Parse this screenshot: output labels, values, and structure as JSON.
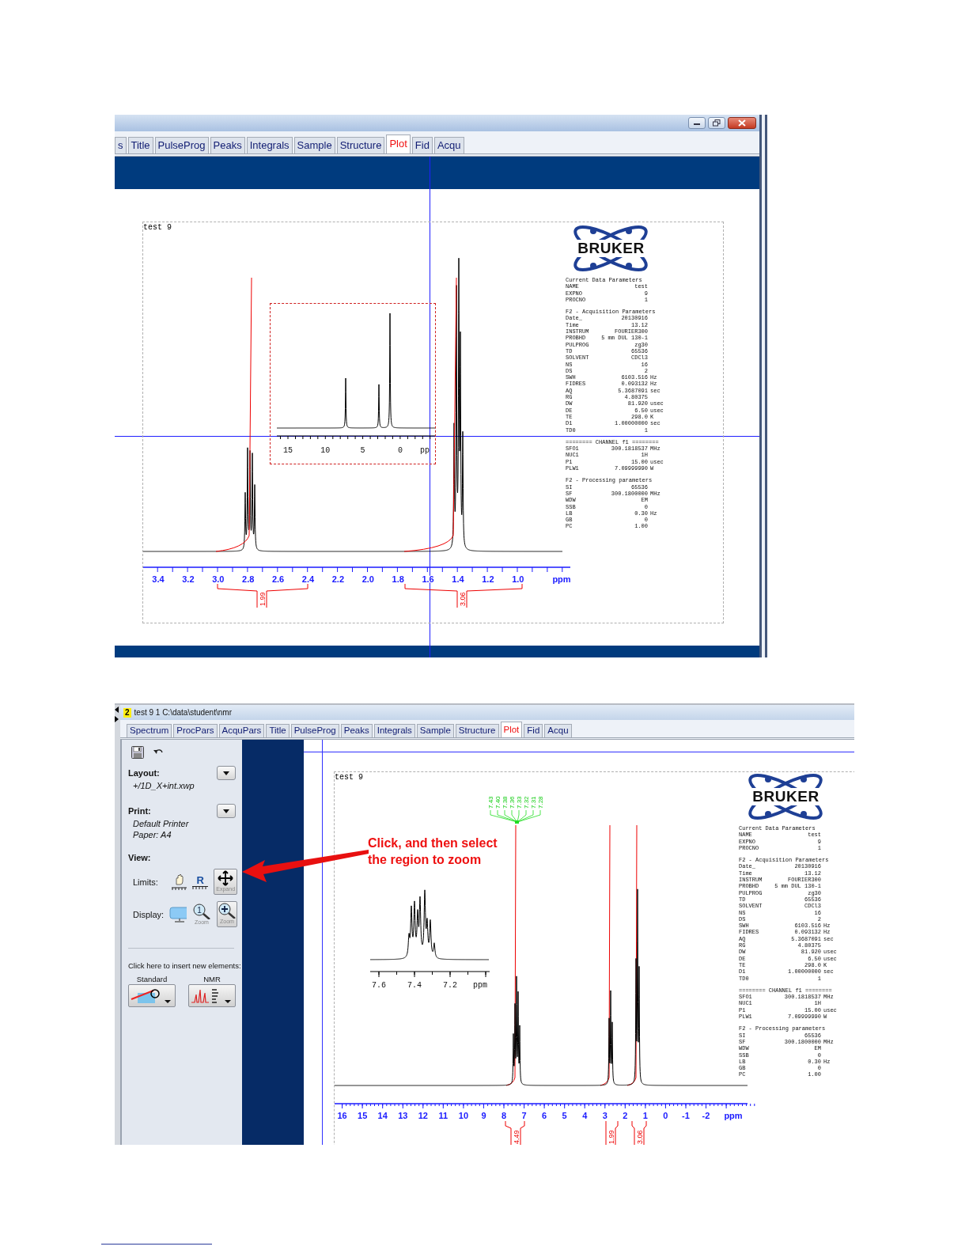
{
  "window_1": {
    "tabs": [
      {
        "label": "s",
        "selected": false
      },
      {
        "label": "Title",
        "selected": false
      },
      {
        "label": "PulseProg",
        "selected": false
      },
      {
        "label": "Peaks",
        "selected": false
      },
      {
        "label": "Integrals",
        "selected": false
      },
      {
        "label": "Sample",
        "selected": false
      },
      {
        "label": "Structure",
        "selected": false
      },
      {
        "label": "Plot",
        "selected": true
      },
      {
        "label": "Fid",
        "selected": false
      },
      {
        "label": "Acqu",
        "selected": false
      }
    ],
    "plot": {
      "page_title": "test 9",
      "logo": "BRUKER",
      "inset_axis_labels": [
        "15",
        "10",
        "5",
        "0"
      ],
      "inset_axis_unit": "pp",
      "axis_labels": [
        "3.4",
        "3.2",
        "3.0",
        "2.8",
        "2.6",
        "2.4",
        "2.2",
        "2.0",
        "1.8",
        "1.6",
        "1.4",
        "1.2",
        "1.0"
      ],
      "axis_unit": "ppm",
      "integrals": [
        "1.99",
        "3.06"
      ],
      "params": [
        {
          "title": "Current Data Parameters",
          "rows": [
            {
              "name": "NAME",
              "value": "test"
            },
            {
              "name": "EXPNO",
              "value": "9"
            },
            {
              "name": "PROCNO",
              "value": "1"
            }
          ]
        },
        {
          "title": "F2 - Acquisition Parameters",
          "rows": [
            {
              "name": "Date_",
              "value": "20130916"
            },
            {
              "name": "Time",
              "value": "13.12"
            },
            {
              "name": "INSTRUM",
              "value": "FOURIER300"
            },
            {
              "name": "PROBHD",
              "value": "5 mm DUL 130-1"
            },
            {
              "name": "PULPROG",
              "value": "zg30"
            },
            {
              "name": "TD",
              "value": "65536"
            },
            {
              "name": "SOLVENT",
              "value": "CDCl3"
            },
            {
              "name": "NS",
              "value": "16"
            },
            {
              "name": "DS",
              "value": "2"
            },
            {
              "name": "SWH",
              "value": "6103.516",
              "unit": "Hz"
            },
            {
              "name": "FIDRES",
              "value": "0.093132",
              "unit": "Hz"
            },
            {
              "name": "AQ",
              "value": "5.3687091",
              "unit": "sec"
            },
            {
              "name": "RG",
              "value": "4.80375"
            },
            {
              "name": "DW",
              "value": "81.920",
              "unit": "usec"
            },
            {
              "name": "DE",
              "value": "6.50",
              "unit": "usec"
            },
            {
              "name": "TE",
              "value": "298.0",
              "unit": "K"
            },
            {
              "name": "D1",
              "value": "1.00000000",
              "unit": "sec"
            },
            {
              "name": "TD0",
              "value": "1"
            }
          ]
        },
        {
          "title": "======== CHANNEL f1 ========",
          "rows": [
            {
              "name": "SFO1",
              "value": "300.1818537",
              "unit": "MHz"
            },
            {
              "name": "NUC1",
              "value": "1H"
            },
            {
              "name": "P1",
              "value": "15.00",
              "unit": "usec"
            },
            {
              "name": "PLW1",
              "value": "7.09999990",
              "unit": "W"
            }
          ]
        },
        {
          "title": "F2 - Processing parameters",
          "rows": [
            {
              "name": "SI",
              "value": "65536"
            },
            {
              "name": "SF",
              "value": "300.1800000",
              "unit": "MHz"
            },
            {
              "name": "WDW",
              "value": "EM"
            },
            {
              "name": "SSB",
              "value": "0"
            },
            {
              "name": "LB",
              "value": "0.30",
              "unit": "Hz"
            },
            {
              "name": "GB",
              "value": "0"
            },
            {
              "name": "PC",
              "value": "1.00"
            }
          ]
        }
      ]
    }
  },
  "window_2": {
    "badge": "2",
    "title": "test 9 1 C:\\data\\student\\nmr",
    "tabs": [
      {
        "label": "Spectrum",
        "selected": false
      },
      {
        "label": "ProcPars",
        "selected": false
      },
      {
        "label": "AcquPars",
        "selected": false
      },
      {
        "label": "Title",
        "selected": false
      },
      {
        "label": "PulseProg",
        "selected": false
      },
      {
        "label": "Peaks",
        "selected": false
      },
      {
        "label": "Integrals",
        "selected": false
      },
      {
        "label": "Sample",
        "selected": false
      },
      {
        "label": "Structure",
        "selected": false
      },
      {
        "label": "Plot",
        "selected": true
      },
      {
        "label": "Fid",
        "selected": false
      },
      {
        "label": "Acqu",
        "selected": false
      }
    ],
    "side_panel": {
      "layout_label": "Layout:",
      "layout_value": "+/1D_X+int.xwp",
      "print_label": "Print:",
      "print_values": [
        "Default Printer",
        "Paper: A4"
      ],
      "view_label": "View:",
      "limits_label": "Limits:",
      "limits_r": "R",
      "expand_caption": "Expand",
      "display_label": "Display:",
      "zoom_one": "1",
      "zoom_captions": [
        "Zoom",
        "Zoom"
      ],
      "insert_label": "Click here to insert new elements:",
      "insert_buttons": [
        "Standard",
        "NMR"
      ]
    },
    "annotation": [
      "Click, and then select",
      "the region to zoom"
    ],
    "plot": {
      "page_title": "test 9",
      "logo": "BRUKER",
      "inset_axis_labels": [
        "7.6",
        "7.4",
        "7.2"
      ],
      "inset_axis_unit": "ppm",
      "peak_labels": [
        "7.43",
        "7.40",
        "7.38",
        "7.36",
        "7.33",
        "7.32",
        "7.31",
        "7.28"
      ],
      "axis_labels": [
        "16",
        "15",
        "14",
        "13",
        "12",
        "11",
        "10",
        "9",
        "8",
        "7",
        "6",
        "5",
        "4",
        "3",
        "2",
        "1",
        "0",
        "-1",
        "-2"
      ],
      "axis_unit": "ppm",
      "integrals": [
        "4.49",
        "1.99",
        "3.06"
      ],
      "params": [
        {
          "title": "Current Data Parameters",
          "rows": [
            {
              "name": "NAME",
              "value": "test"
            },
            {
              "name": "EXPNO",
              "value": "9"
            },
            {
              "name": "PROCNO",
              "value": "1"
            }
          ]
        },
        {
          "title": "F2 - Acquisition Parameters",
          "rows": [
            {
              "name": "Date_",
              "value": "20130916"
            },
            {
              "name": "Time",
              "value": "13.12"
            },
            {
              "name": "INSTRUM",
              "value": "FOURIER300"
            },
            {
              "name": "PROBHD",
              "value": "5 mm DUL 130-1"
            },
            {
              "name": "PULPROG",
              "value": "zg30"
            },
            {
              "name": "TD",
              "value": "65536"
            },
            {
              "name": "SOLVENT",
              "value": "CDCl3"
            },
            {
              "name": "NS",
              "value": "16"
            },
            {
              "name": "DS",
              "value": "2"
            },
            {
              "name": "SWH",
              "value": "6103.516",
              "unit": "Hz"
            },
            {
              "name": "FIDRES",
              "value": "0.093132",
              "unit": "Hz"
            },
            {
              "name": "AQ",
              "value": "5.3687091",
              "unit": "sec"
            },
            {
              "name": "RG",
              "value": "4.80375"
            },
            {
              "name": "DW",
              "value": "81.920",
              "unit": "usec"
            },
            {
              "name": "DE",
              "value": "6.50",
              "unit": "usec"
            },
            {
              "name": "TE",
              "value": "298.0",
              "unit": "K"
            },
            {
              "name": "D1",
              "value": "1.00000000",
              "unit": "sec"
            },
            {
              "name": "TD0",
              "value": "1"
            }
          ]
        },
        {
          "title": "======== CHANNEL f1 ========",
          "rows": [
            {
              "name": "SFO1",
              "value": "300.1818537",
              "unit": "MHz"
            },
            {
              "name": "NUC1",
              "value": "1H"
            },
            {
              "name": "P1",
              "value": "15.00",
              "unit": "usec"
            },
            {
              "name": "PLW1",
              "value": "7.09999990",
              "unit": "W"
            }
          ]
        },
        {
          "title": "F2 - Processing parameters",
          "rows": [
            {
              "name": "SI",
              "value": "65536"
            },
            {
              "name": "SF",
              "value": "300.1800000",
              "unit": "MHz"
            },
            {
              "name": "WDW",
              "value": "EM"
            },
            {
              "name": "SSB",
              "value": "0"
            },
            {
              "name": "LB",
              "value": "0.30",
              "unit": "Hz"
            },
            {
              "name": "GB",
              "value": "0"
            },
            {
              "name": "PC",
              "value": "1.00"
            }
          ]
        }
      ]
    }
  }
}
